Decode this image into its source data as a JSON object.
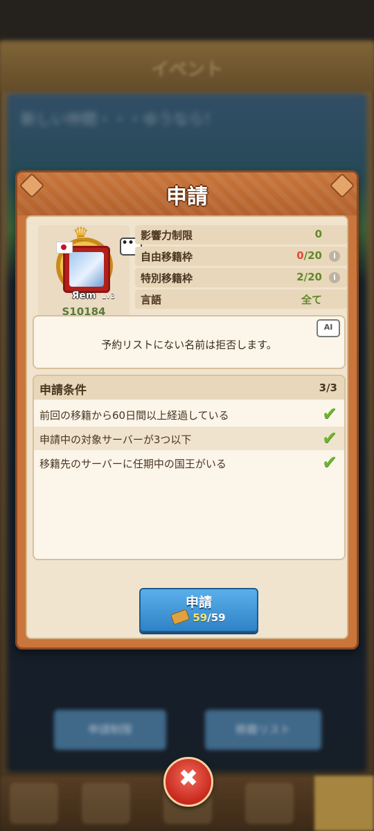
{
  "background": {
    "header_title": "イベント",
    "panel_title": "新しい仲間・・・ゆうなら！",
    "button_left": "申請制限",
    "button_right": "移籍リスト"
  },
  "dialog": {
    "title": "申請",
    "profile": {
      "name": "Яem",
      "level_badge": "Lv3",
      "server_id": "S10184",
      "chat_icon_text": "•••"
    },
    "info": [
      {
        "label": "影響力制限",
        "value": "0",
        "has_info_icon": false
      },
      {
        "label": "自由移籍枠",
        "value_current": "0",
        "value_total": "/20",
        "has_info_icon": true
      },
      {
        "label": "特別移籍枠",
        "value": "2/20",
        "has_info_icon": true
      },
      {
        "label": "言語",
        "value": "全て",
        "has_info_icon": false
      }
    ],
    "description": "予約リストにない名前は拒否します。",
    "ai_label": "AI",
    "conditions": {
      "title": "申請条件",
      "count": "3/3",
      "items": [
        {
          "text": "前回の移籍から60日間以上経過している",
          "met": true
        },
        {
          "text": "申請中の対象サーバーが3つ以下",
          "met": true
        },
        {
          "text": "移籍先のサーバーに任期中の国王がいる",
          "met": true
        }
      ]
    },
    "apply_button": {
      "label": "申請",
      "cost_have": "59",
      "cost_total": "/59"
    }
  },
  "close_button": {
    "glyph": "✖"
  },
  "colors": {
    "dialog_frame": "#c9753c",
    "panel_bg": "#f0e4ce",
    "accent_green": "#5f8a2b",
    "warning_red": "#e24a3a",
    "button_blue": "#2f82c6",
    "close_red": "#c8281d"
  }
}
